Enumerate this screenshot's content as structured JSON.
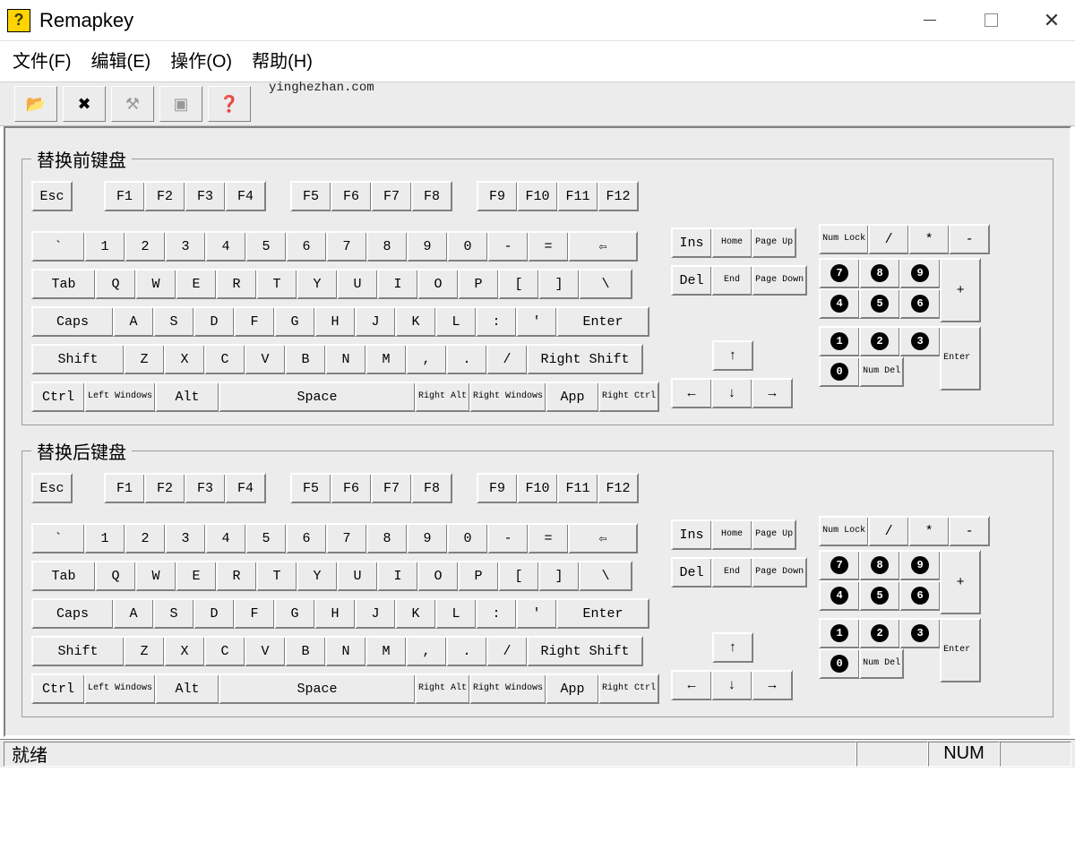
{
  "window": {
    "title": "Remapkey",
    "icon_glyph": "?"
  },
  "menus": {
    "file": "文件(F)",
    "edit": "编辑(E)",
    "ops": "操作(O)",
    "help": "帮助(H)"
  },
  "watermark": "yinghezhan.com",
  "toolbar": {
    "open": "📂",
    "delete": "✖",
    "build": "⚒",
    "preview": "▣",
    "help": "❓"
  },
  "groups": {
    "before": "替换前键盘",
    "after": "替换后键盘"
  },
  "keys": {
    "esc": "Esc",
    "f1": "F1",
    "f2": "F2",
    "f3": "F3",
    "f4": "F4",
    "f5": "F5",
    "f6": "F6",
    "f7": "F7",
    "f8": "F8",
    "f9": "F9",
    "f10": "F10",
    "f11": "F11",
    "f12": "F12",
    "grave": "`",
    "n1": "1",
    "n2": "2",
    "n3": "3",
    "n4": "4",
    "n5": "5",
    "n6": "6",
    "n7": "7",
    "n8": "8",
    "n9": "9",
    "n0": "0",
    "minus": "-",
    "equal": "=",
    "bksp": "⇦",
    "tab": "Tab",
    "q": "Q",
    "w": "W",
    "e": "E",
    "r": "R",
    "t": "T",
    "y": "Y",
    "u": "U",
    "i": "I",
    "o": "O",
    "p": "P",
    "lbr": "[",
    "rbr": "]",
    "bslash": "\\",
    "caps": "Caps",
    "a": "A",
    "s": "S",
    "d": "D",
    "f": "F",
    "g": "G",
    "h": "H",
    "j": "J",
    "k": "K",
    "l": "L",
    "scol": ":",
    "quot": "'",
    "enter": "Enter",
    "lshift": "Shift",
    "z": "Z",
    "x": "X",
    "c": "C",
    "v": "V",
    "b": "B",
    "n": "N",
    "m": "M",
    "comma": ",",
    "dot": ".",
    "slash": "/",
    "rshift": "Right Shift",
    "lctrl": "Ctrl",
    "lwin": "Left Windows",
    "lalt": "Alt",
    "space": "Space",
    "ralt": "Right Alt",
    "rwin": "Right Windows",
    "app": "App",
    "rctrl": "Right Ctrl",
    "ins": "Ins",
    "home": "Home",
    "pgup": "Page Up",
    "del": "Del",
    "end": "End",
    "pgdn": "Page Down",
    "up": "↑",
    "left": "←",
    "down": "↓",
    "right": "→",
    "numlock": "Num Lock",
    "kpslash": "/",
    "kpstar": "*",
    "kpminus": "-",
    "kpplus": "+",
    "kpenter": "Enter",
    "kp7": "7",
    "kp8": "8",
    "kp9": "9",
    "kp4": "4",
    "kp5": "5",
    "kp6": "6",
    "kp1": "1",
    "kp2": "2",
    "kp3": "3",
    "kp0": "0",
    "kpdel": "Num Del"
  },
  "status": {
    "ready": "就绪",
    "num": "NUM"
  }
}
